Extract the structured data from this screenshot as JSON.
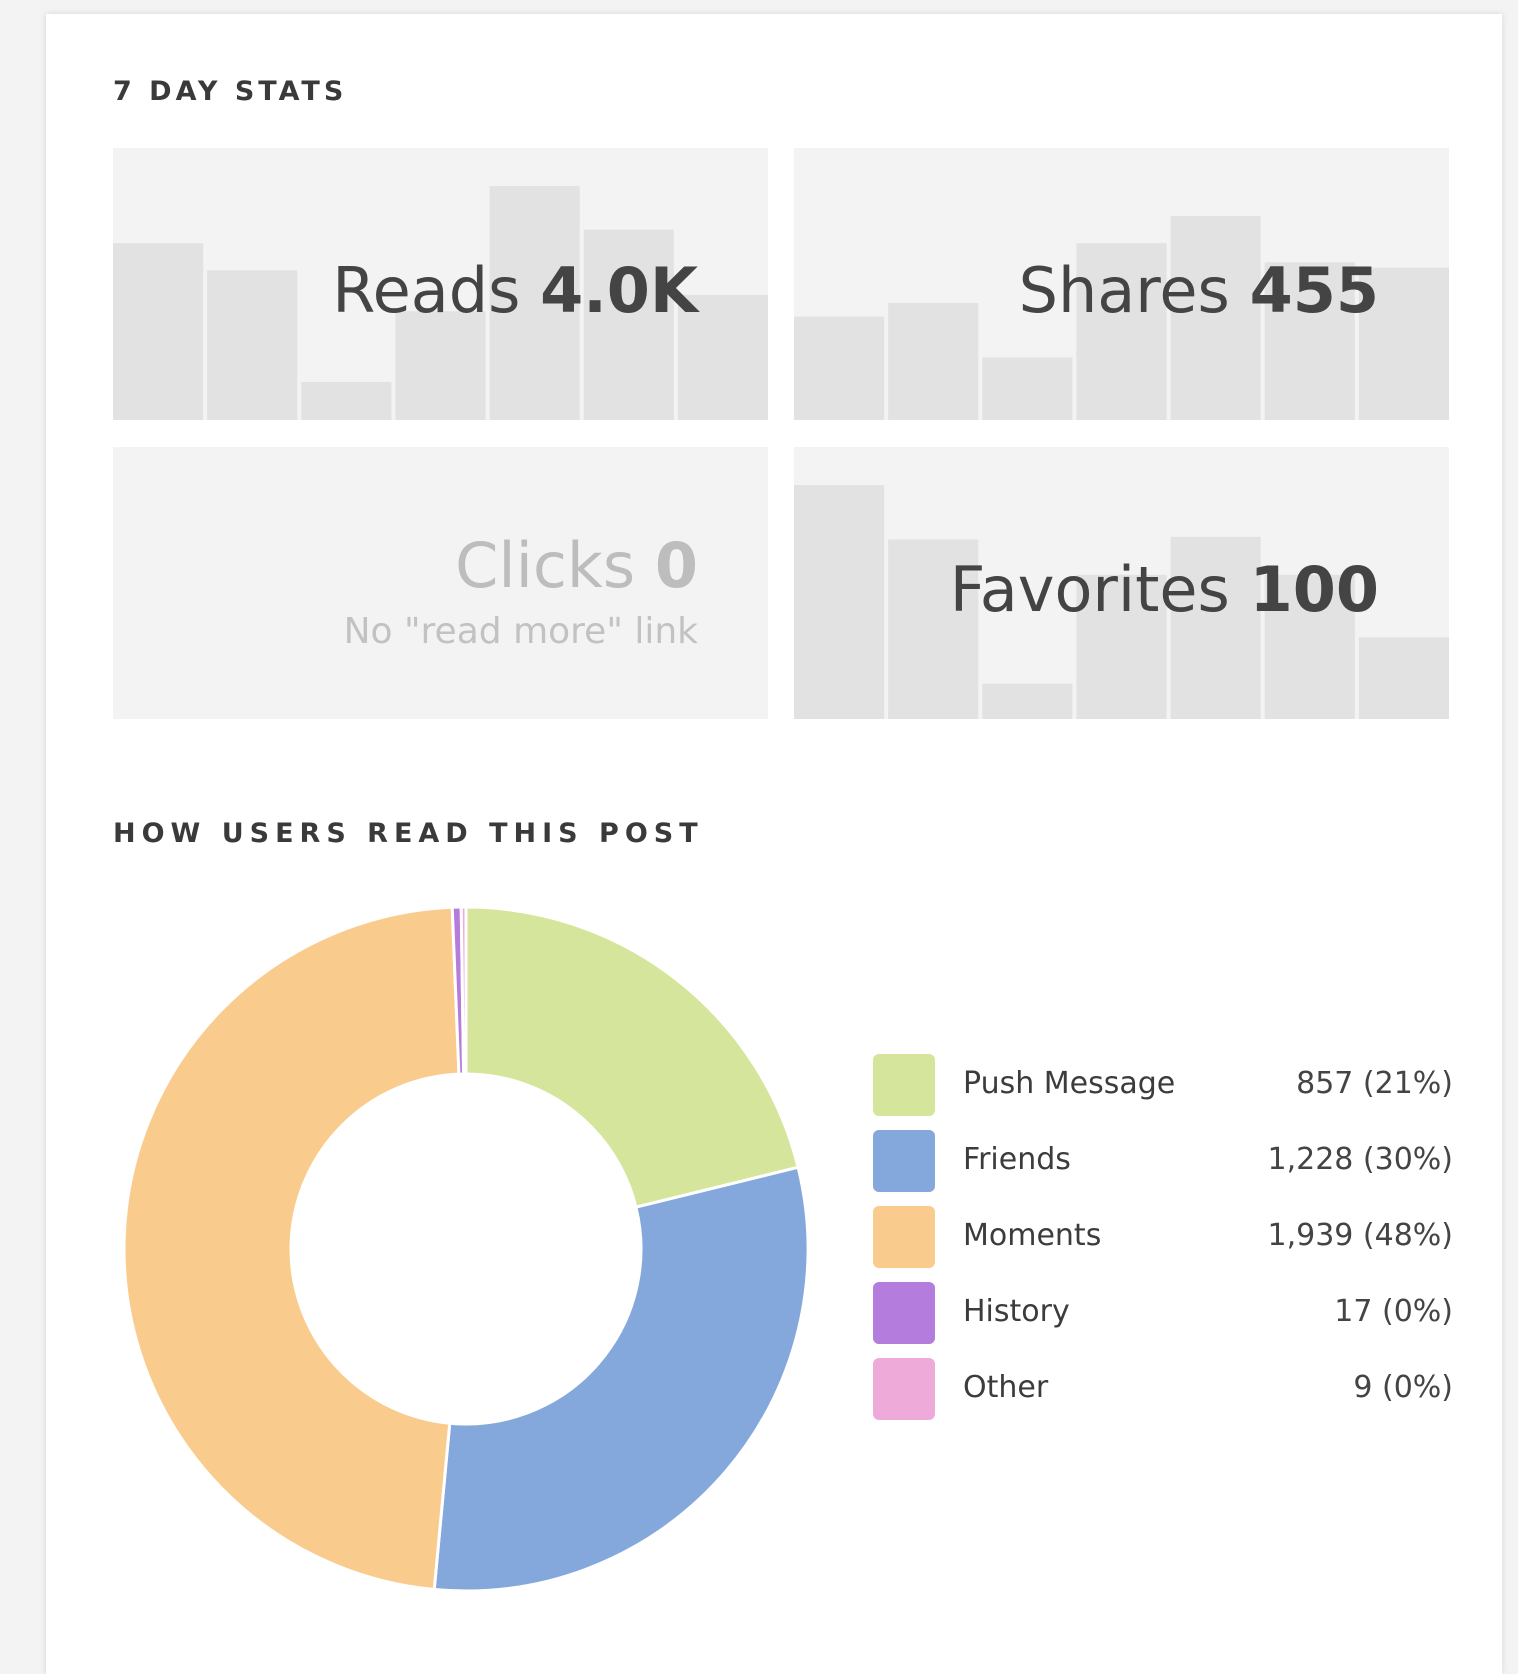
{
  "stats": {
    "heading": "7 DAY STATS",
    "tiles": {
      "reads": {
        "label": "Reads",
        "value": "4.0K",
        "bars": [
          0.65,
          0.55,
          0.14,
          0.4,
          0.86,
          0.7,
          0.46
        ]
      },
      "shares": {
        "label": "Shares",
        "value": "455",
        "bars": [
          0.38,
          0.43,
          0.23,
          0.65,
          0.75,
          0.58,
          0.56
        ]
      },
      "clicks": {
        "label": "Clicks",
        "value": "0",
        "note": "No \"read more\" link"
      },
      "favorites": {
        "label": "Favorites",
        "value": "100",
        "bars": [
          0.86,
          0.66,
          0.13,
          0.53,
          0.67,
          0.53,
          0.3
        ]
      }
    }
  },
  "breakdown": {
    "heading": "HOW USERS READ THIS POST",
    "items": [
      {
        "label": "Push Message",
        "value_text": "857 (21%)",
        "color": "#d6e59c"
      },
      {
        "label": "Friends",
        "value_text": "1,228 (30%)",
        "color": "#85a8dc"
      },
      {
        "label": "Moments",
        "value_text": "1,939 (48%)",
        "color": "#f9cc8e"
      },
      {
        "label": "History",
        "value_text": "17 (0%)",
        "color": "#b47ddd"
      },
      {
        "label": "Other",
        "value_text": "9 (0%)",
        "color": "#eeabd9"
      }
    ]
  },
  "chart_data": [
    {
      "type": "bar",
      "title": "Reads",
      "values": [
        0.65,
        0.55,
        0.14,
        0.4,
        0.86,
        0.7,
        0.46
      ]
    },
    {
      "type": "bar",
      "title": "Shares",
      "values": [
        0.38,
        0.43,
        0.23,
        0.65,
        0.75,
        0.58,
        0.56
      ]
    },
    {
      "type": "bar",
      "title": "Favorites",
      "values": [
        0.86,
        0.66,
        0.13,
        0.53,
        0.67,
        0.53,
        0.3
      ]
    },
    {
      "type": "pie",
      "title": "HOW USERS READ THIS POST",
      "categories": [
        "Push Message",
        "Friends",
        "Moments",
        "History",
        "Other"
      ],
      "values": [
        857,
        1228,
        1939,
        17,
        9
      ],
      "colors": [
        "#d6e59c",
        "#85a8dc",
        "#f9cc8e",
        "#b47ddd",
        "#eeabd9"
      ]
    }
  ]
}
